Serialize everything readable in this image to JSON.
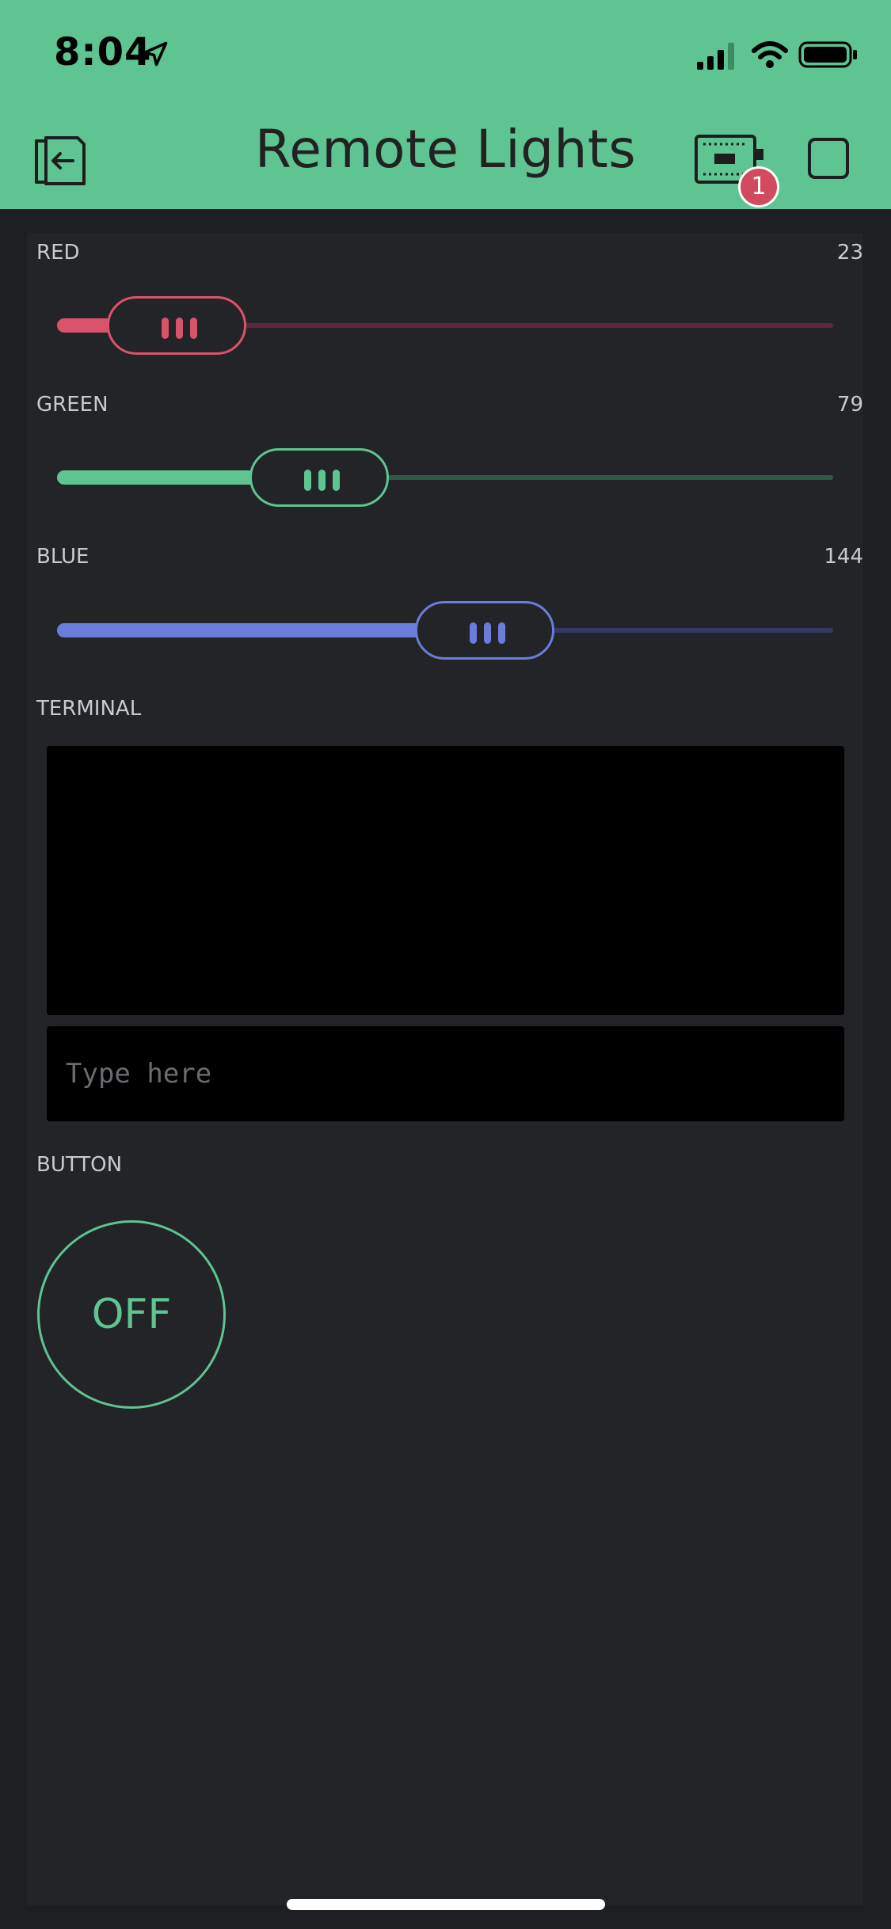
{
  "status_bar": {
    "time": "8:04"
  },
  "header": {
    "title": "Remote Lights",
    "device_badge": "1"
  },
  "sliders": [
    {
      "label": "RED",
      "value": "23",
      "fraction": 0.09,
      "color": "#d9536a",
      "track_color": "#5a2b36"
    },
    {
      "label": "GREEN",
      "value": "79",
      "fraction": 0.31,
      "color": "#5ec491",
      "track_color": "#2d5a44"
    },
    {
      "label": "BLUE",
      "value": "144",
      "fraction": 0.565,
      "color": "#6b7ddb",
      "track_color": "#343a66"
    }
  ],
  "terminal": {
    "label": "TERMINAL",
    "input_placeholder": "Type here"
  },
  "button": {
    "label": "BUTTON",
    "state_text": "OFF",
    "color": "#5ec491"
  },
  "colors": {
    "header_bg": "#5ec491",
    "panel_bg": "#222428",
    "page_bg": "#1c1e22"
  }
}
